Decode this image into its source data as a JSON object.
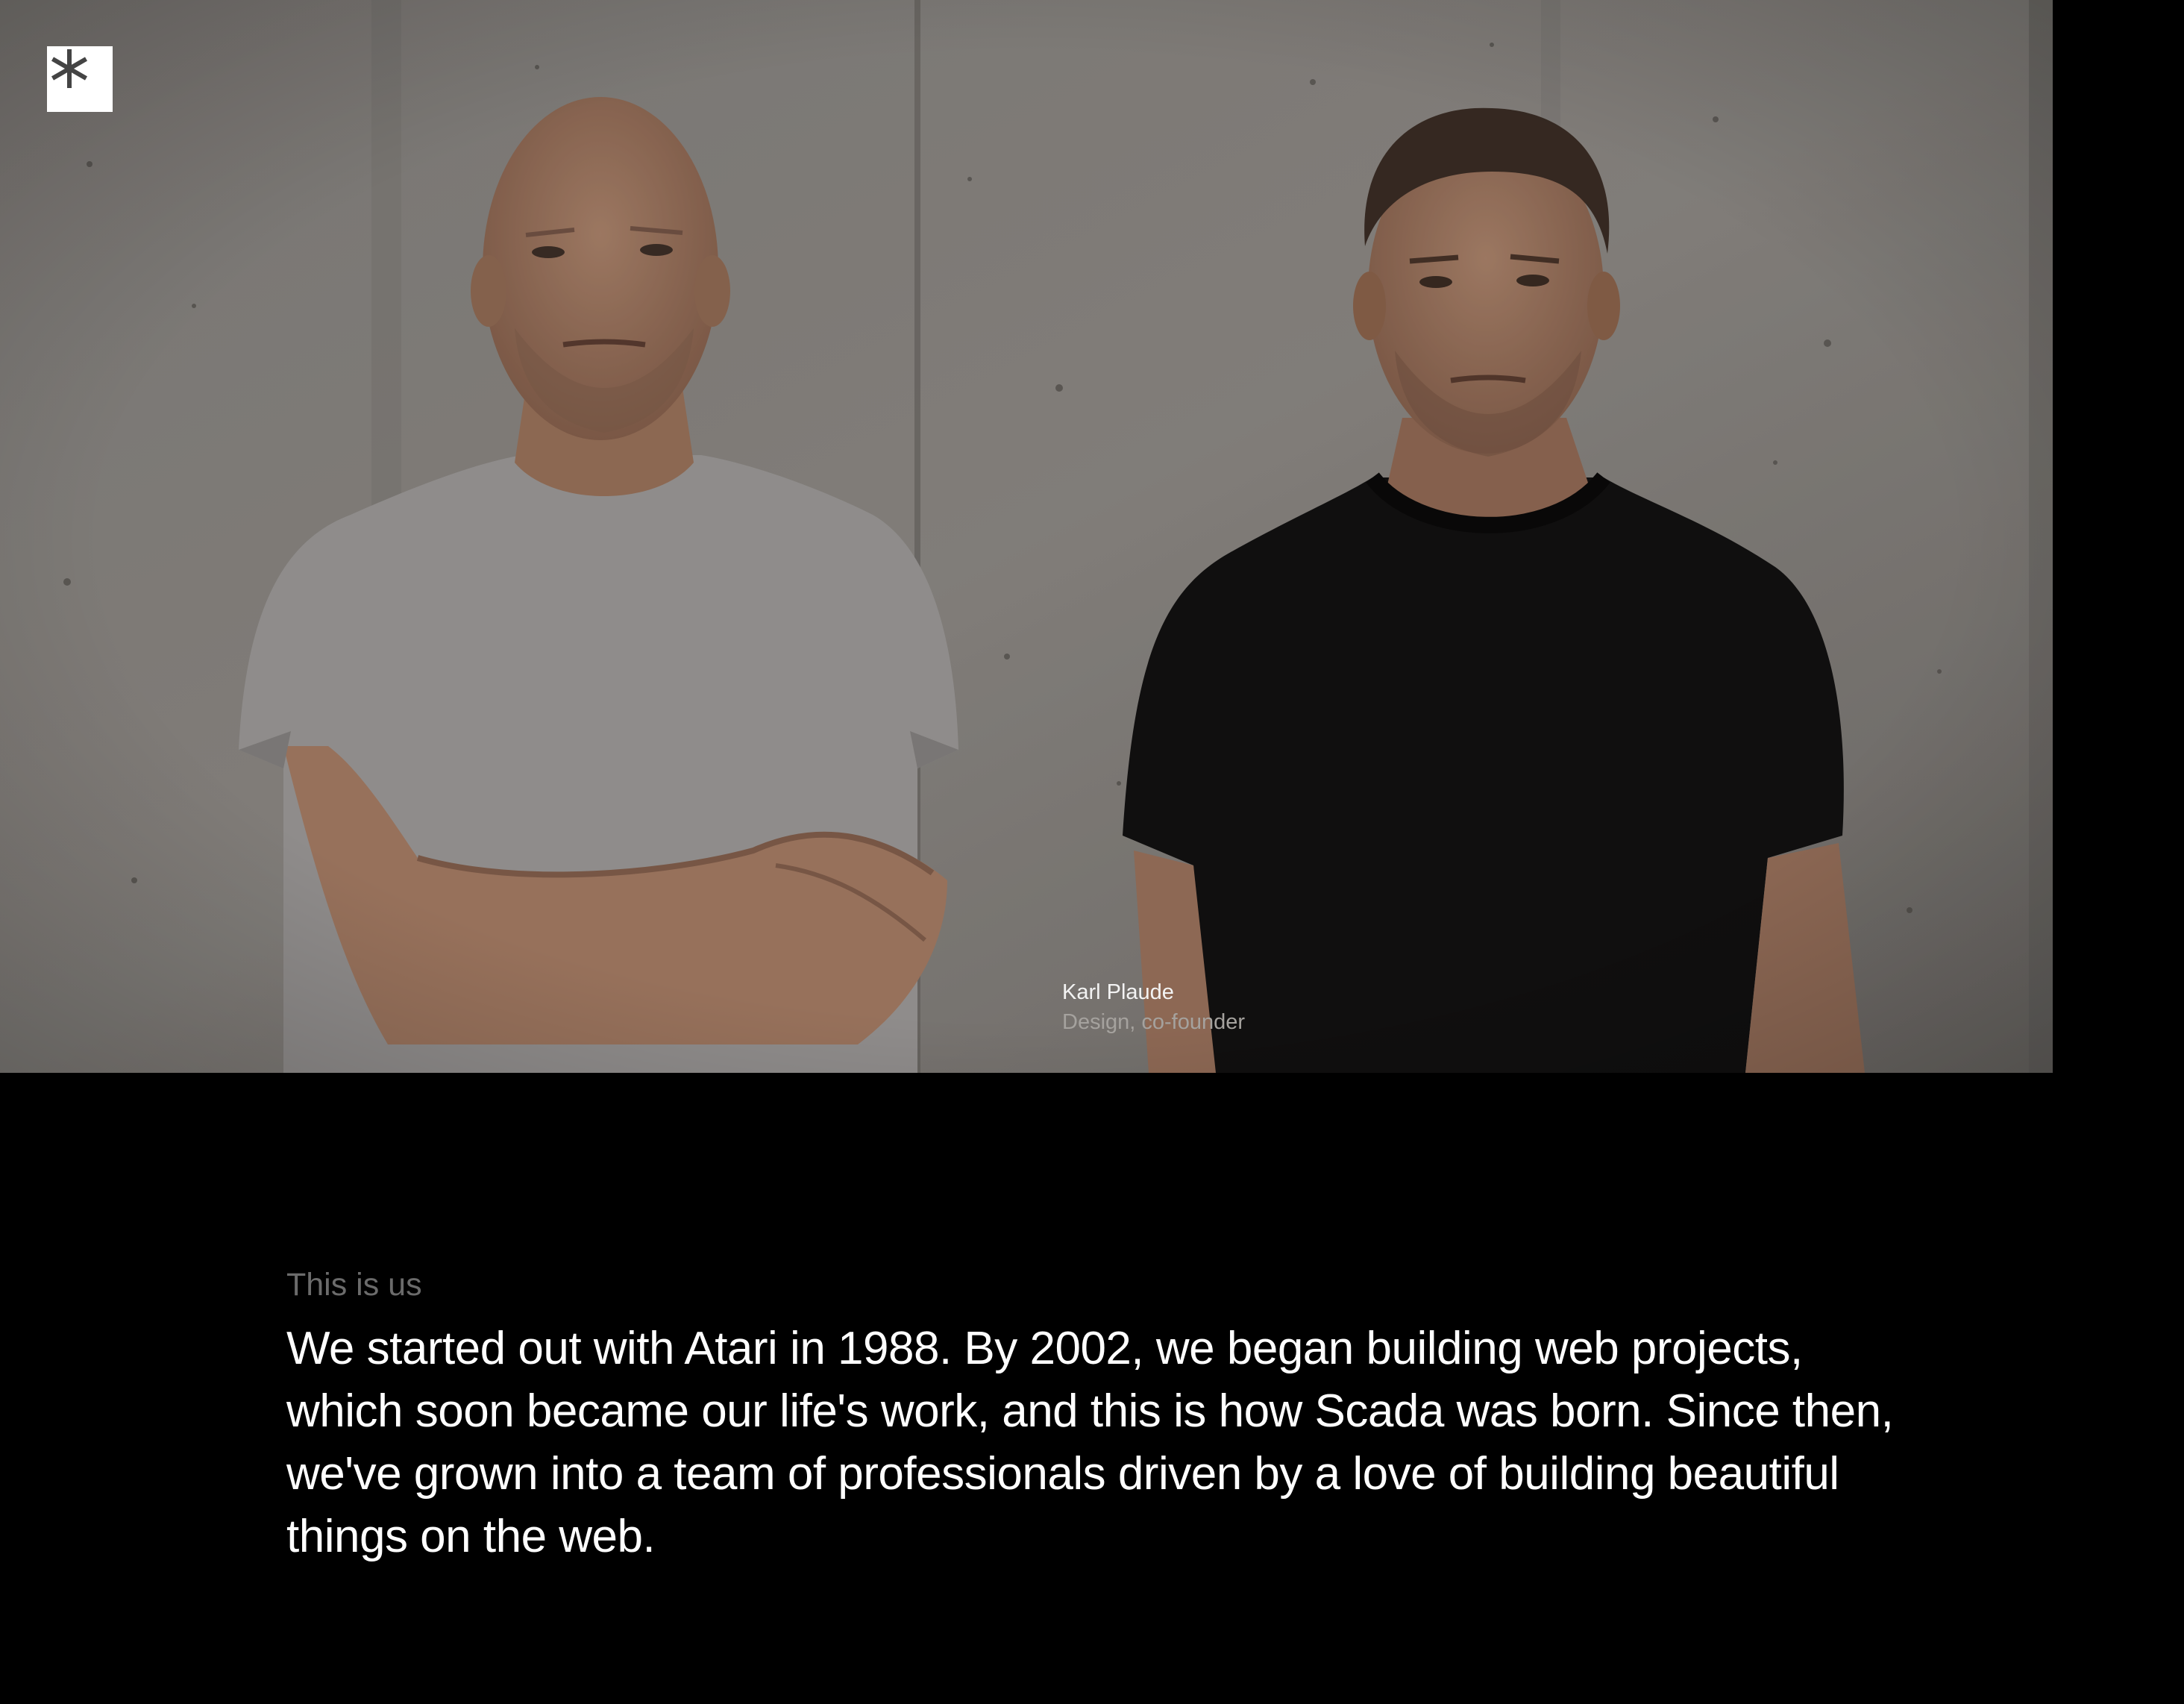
{
  "logo": {
    "icon": "asterisk-icon",
    "background": "#ffffff",
    "color": "#444444"
  },
  "hero": {
    "photo": "two-founders-photo",
    "caption": {
      "name": "Karl Plaude",
      "role": "Design, co-founder"
    }
  },
  "about": {
    "eyebrow": "This is us",
    "text": "We started out with Atari in 1988. By 2002, we began building web projects, which soon became our life's work, and this is how Scada was born. Since then, we've grown into a team of professionals driven by a love of building beautiful things on the web."
  },
  "colors": {
    "page_background": "#000000",
    "body_text": "#ffffff",
    "eyebrow_text": "#6b6b6b",
    "caption_role": "#a5a29e"
  }
}
